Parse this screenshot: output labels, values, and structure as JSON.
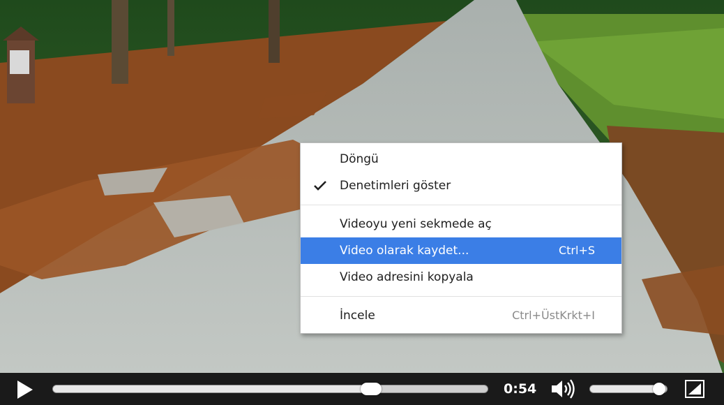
{
  "context_menu": {
    "items": [
      {
        "label": "Döngü",
        "checked": false,
        "shortcut": ""
      },
      {
        "label": "Denetimleri göster",
        "checked": true,
        "shortcut": ""
      },
      {
        "label": "Videoyu yeni sekmede aç",
        "checked": false,
        "shortcut": ""
      },
      {
        "label": "Video olarak kaydet...",
        "checked": false,
        "shortcut": "Ctrl+S",
        "highlighted": true
      },
      {
        "label": "Video adresini kopyala",
        "checked": false,
        "shortcut": ""
      },
      {
        "label": "İncele",
        "checked": false,
        "shortcut": "Ctrl+ÜstKrkt+I"
      }
    ],
    "highlight_color": "#3b7ee6"
  },
  "player": {
    "time_display": "0:54",
    "progress_fraction": 0.732,
    "volume_fraction": 0.9,
    "icons": {
      "play": "play-icon",
      "volume": "volume-icon",
      "fullscreen": "fullscreen-icon",
      "check": "check-icon"
    }
  }
}
